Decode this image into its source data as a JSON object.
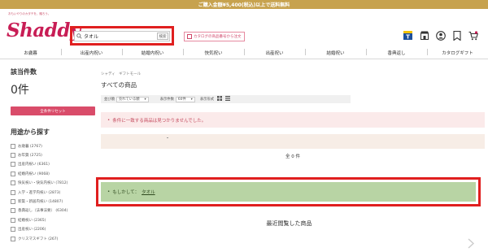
{
  "topbar": {
    "text": "ご購入金額¥5,400(税込)以上で送料無料"
  },
  "header": {
    "tagline": "おもいやりのカタチを、贈ろう。",
    "logo": "Shaddy",
    "search": {
      "value": "タオル",
      "button_label": "検索"
    },
    "catalog_link": "カタログの商品番号から注文",
    "icons": [
      "t-point-icon",
      "store-icon",
      "account-icon",
      "favorite-icon",
      "cart-icon"
    ]
  },
  "nav": {
    "items": [
      "お歳暮",
      "出産内祝い",
      "結婚内祝い",
      "快気祝い",
      "出産祝い",
      "結婚祝い",
      "香典返し",
      "カタログギフト"
    ]
  },
  "sidebar": {
    "count_title": "該当件数",
    "count_value": "0件",
    "reset_label": "全条件リセット",
    "usage_title": "用途から探す",
    "usage_items": [
      "お歳暮 (2767)",
      "お年賀 (2725)",
      "出産内祝い (6361)",
      "結婚内祝い (9068)",
      "快気祝い・快気内祝い (7812)",
      "入学・進学内祝い (2873)",
      "新築・新居内祝い (14807)",
      "香典返し（法事法要） (6304)",
      "結婚祝い (2365)",
      "出産祝い (2206)",
      "クリスマスギフト (267)"
    ]
  },
  "main": {
    "breadcrumb": "シャディ　ギフトモール",
    "title": "すべての商品",
    "sort": {
      "label": "並び順",
      "value": "売れている順",
      "per_page_label": "表示件数",
      "per_page_value": "60件",
      "view_label": "表示形式"
    },
    "notice": "条件に一致する商品は見つかりませんでした。",
    "total": "全 0 件",
    "suggest_prefix": "もしかして：",
    "suggest_link": "タオル",
    "recent_title": "最近閲覧した商品"
  },
  "colors": {
    "accent": "#c81d55",
    "topbar": "#c7a24e",
    "highlight_frame": "#e01f1f",
    "suggest_bg": "#b8d4a4",
    "notice_bg": "#fbeaea"
  }
}
